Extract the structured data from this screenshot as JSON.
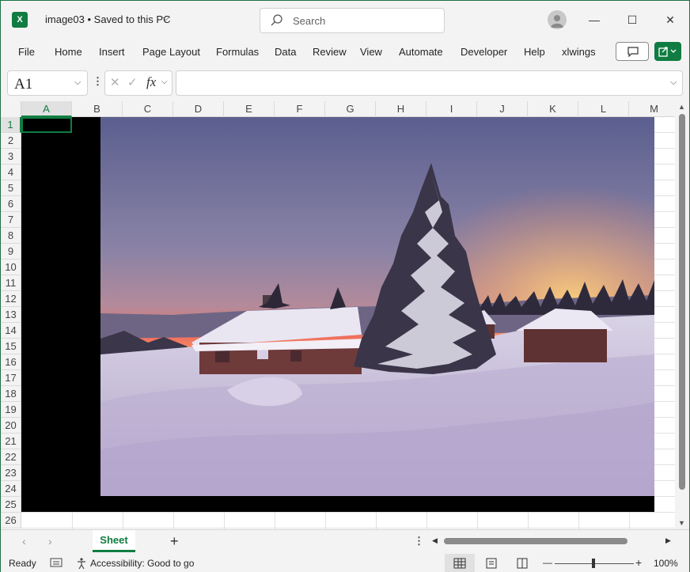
{
  "titlebar": {
    "app_icon_label": "X",
    "doc_title": "image03 • Saved to this PC",
    "search_placeholder": "Search",
    "minimize": "—",
    "maximize": "☐",
    "close": "✕"
  },
  "ribbon": {
    "tabs": [
      "File",
      "Home",
      "Insert",
      "Page Layout",
      "Formulas",
      "Data",
      "Review",
      "View",
      "Automate",
      "Developer",
      "Help",
      "xlwings"
    ]
  },
  "formula_bar": {
    "name_box": "A1",
    "fx": "fx",
    "formula": ""
  },
  "grid": {
    "columns": [
      "A",
      "B",
      "C",
      "D",
      "E",
      "F",
      "G",
      "H",
      "I",
      "J",
      "K",
      "L",
      "M"
    ],
    "rows": [
      "1",
      "2",
      "3",
      "4",
      "5",
      "6",
      "7",
      "8",
      "9",
      "10",
      "11",
      "12",
      "13",
      "14",
      "15",
      "16",
      "17",
      "18",
      "19",
      "20",
      "21",
      "22",
      "23",
      "24",
      "25",
      "26"
    ],
    "selected_cell": "A1"
  },
  "sheets": {
    "tabs": [
      "Sheet"
    ],
    "add": "+"
  },
  "status": {
    "ready": "Ready",
    "accessibility": "Accessibility: Good to go",
    "zoom": "100%",
    "zoom_minus": "—",
    "zoom_plus": "+"
  },
  "icons": {
    "app": "excel-icon",
    "search": "search-icon",
    "avatar": "user-icon",
    "comment": "comment-icon",
    "share": "share-icon"
  }
}
